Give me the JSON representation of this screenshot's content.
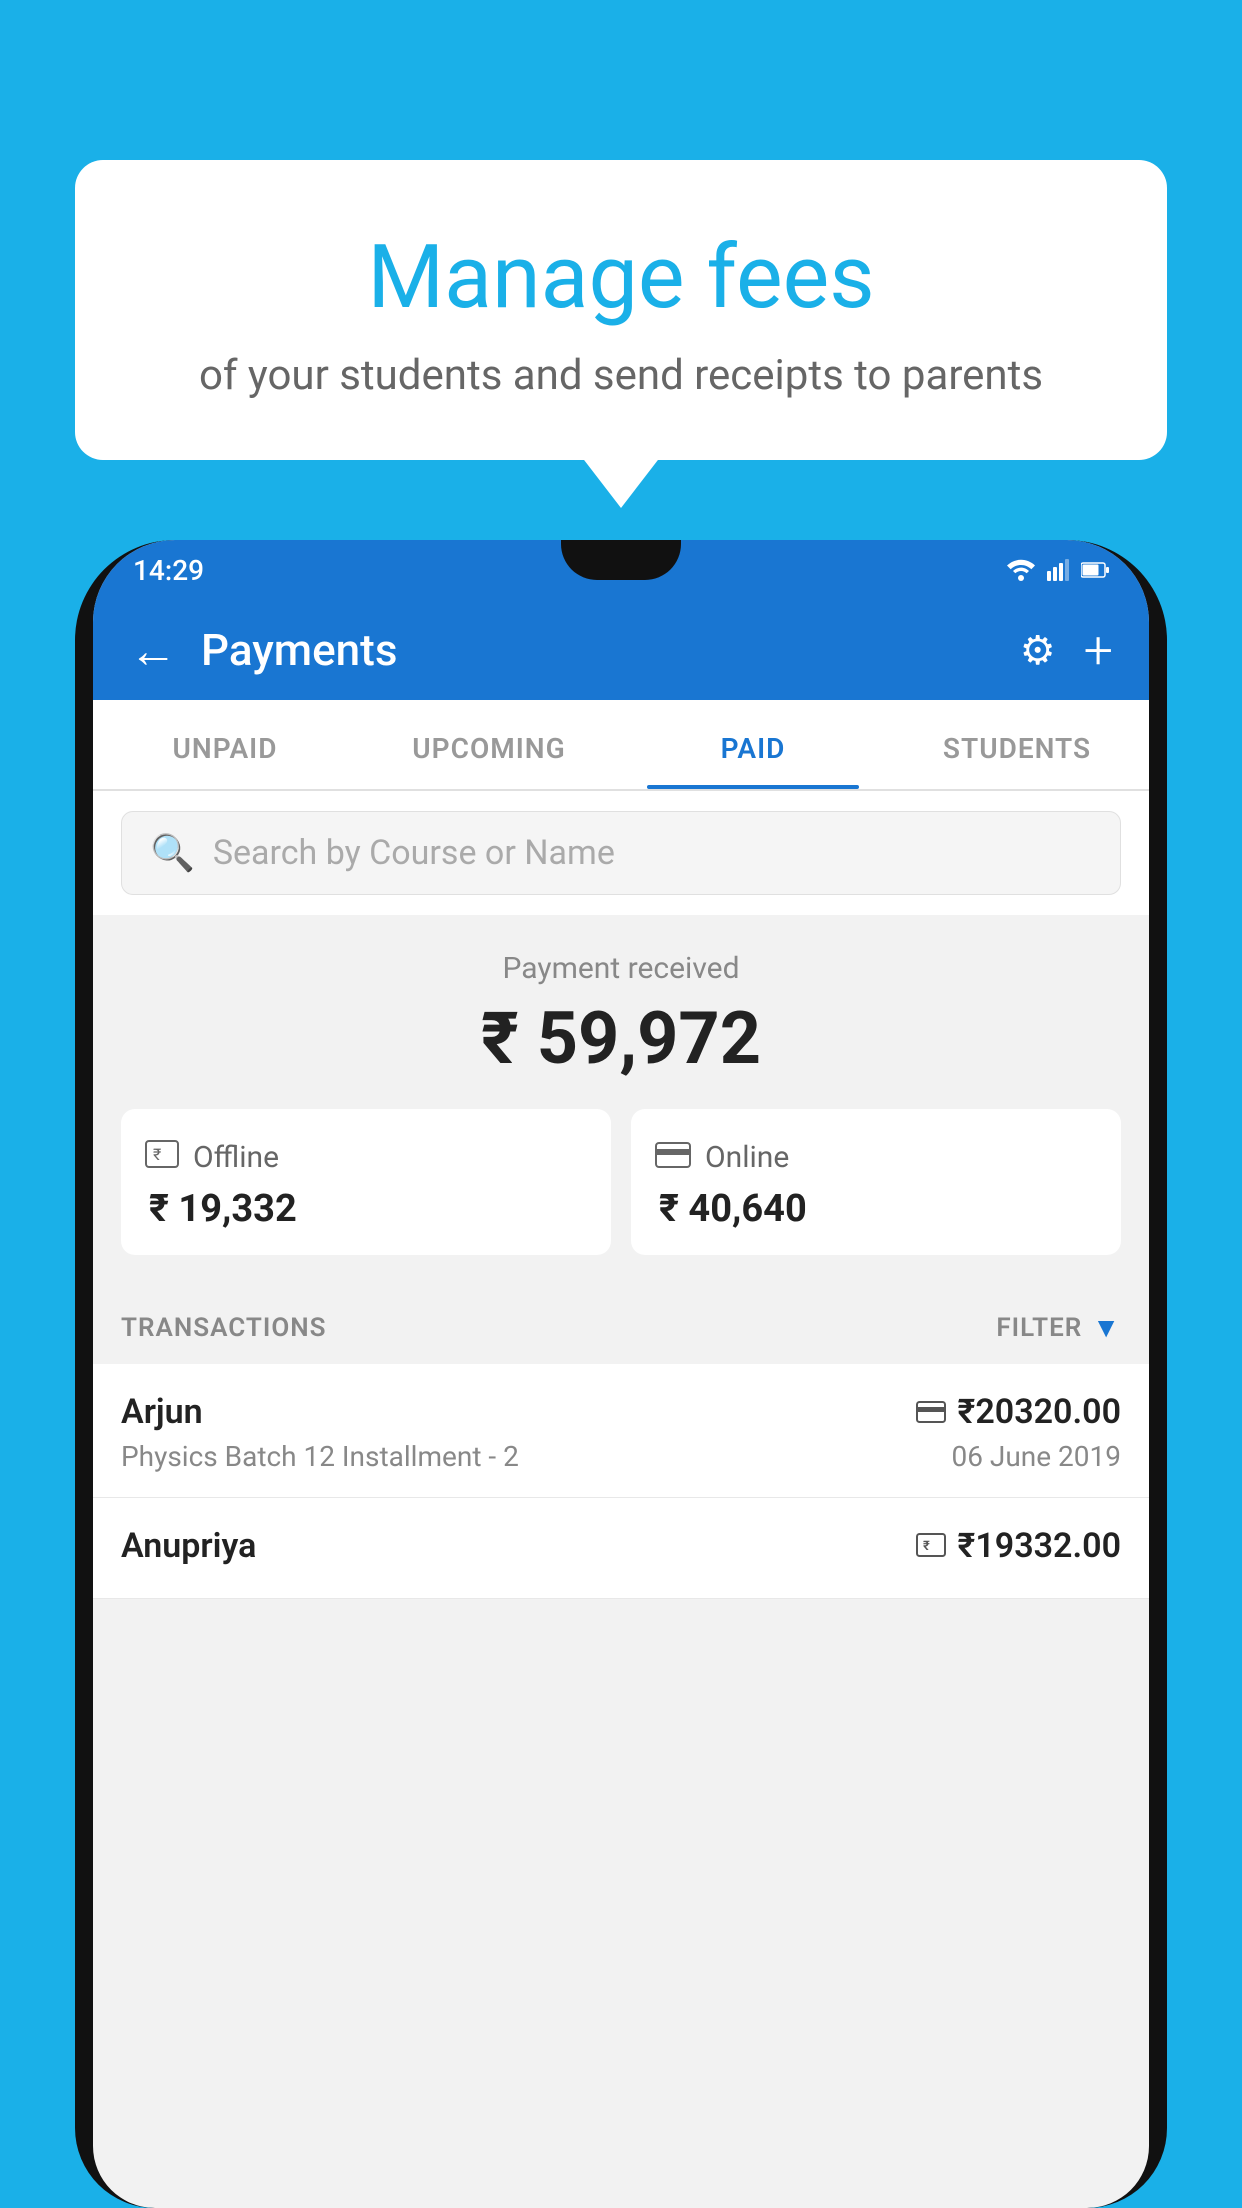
{
  "background_color": "#1ab0e8",
  "tooltip": {
    "title": "Manage fees",
    "subtitle": "of your students and send receipts to parents"
  },
  "status_bar": {
    "time": "14:29"
  },
  "app_bar": {
    "title": "Payments",
    "back_label": "←",
    "settings_label": "⚙",
    "add_label": "+"
  },
  "tabs": [
    {
      "label": "UNPAID",
      "active": false
    },
    {
      "label": "UPCOMING",
      "active": false
    },
    {
      "label": "PAID",
      "active": true
    },
    {
      "label": "STUDENTS",
      "active": false
    }
  ],
  "search": {
    "placeholder": "Search by Course or Name"
  },
  "payment_summary": {
    "label": "Payment received",
    "amount": "₹ 59,972",
    "offline": {
      "label": "Offline",
      "amount": "₹ 19,332"
    },
    "online": {
      "label": "Online",
      "amount": "₹ 40,640"
    }
  },
  "transactions": {
    "header_label": "TRANSACTIONS",
    "filter_label": "FILTER",
    "items": [
      {
        "name": "Arjun",
        "amount": "₹20320.00",
        "course": "Physics Batch 12 Installment - 2",
        "date": "06 June 2019",
        "payment_type": "online"
      },
      {
        "name": "Anupriya",
        "amount": "₹19332.00",
        "course": "",
        "date": "",
        "payment_type": "offline"
      }
    ]
  }
}
